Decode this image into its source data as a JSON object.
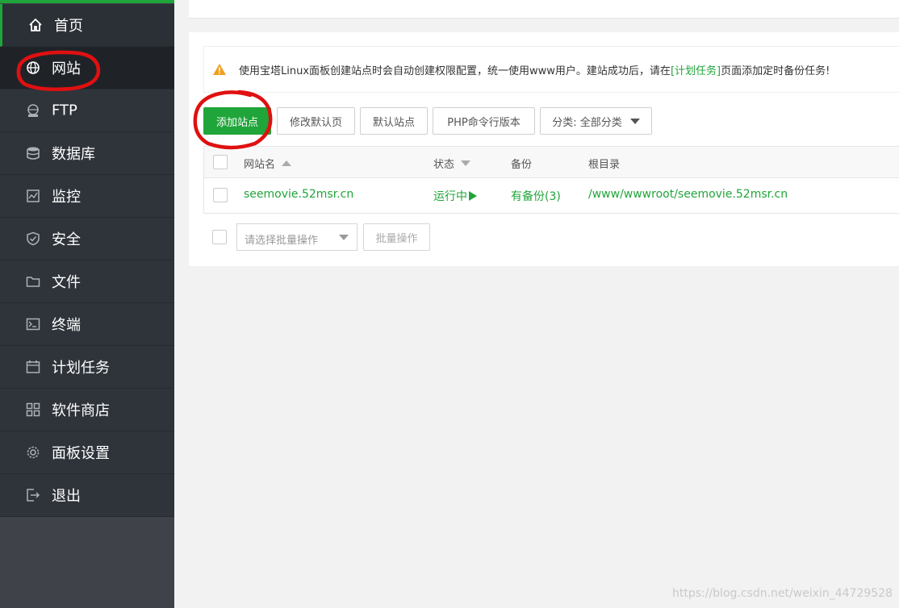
{
  "sidebar": {
    "items": [
      {
        "label": "首页",
        "icon": "home-icon"
      },
      {
        "label": "网站",
        "icon": "globe-icon"
      },
      {
        "label": "FTP",
        "icon": "ftp-icon"
      },
      {
        "label": "数据库",
        "icon": "database-icon"
      },
      {
        "label": "监控",
        "icon": "monitor-icon"
      },
      {
        "label": "安全",
        "icon": "shield-icon"
      },
      {
        "label": "文件",
        "icon": "folder-icon"
      },
      {
        "label": "终端",
        "icon": "terminal-icon"
      },
      {
        "label": "计划任务",
        "icon": "calendar-icon"
      },
      {
        "label": "软件商店",
        "icon": "apps-grid-icon"
      },
      {
        "label": "面板设置",
        "icon": "gear-icon"
      },
      {
        "label": "退出",
        "icon": "logout-icon"
      }
    ]
  },
  "notice": {
    "text_before": "使用宝塔Linux面板创建站点时会自动创建权限配置，统一使用www用户。建站成功后，请在",
    "link": "[计划任务]",
    "text_after": "页面添加定时备份任务!"
  },
  "toolbar": {
    "add_site": "添加站点",
    "modify_default_page": "修改默认页",
    "default_site": "默认站点",
    "php_cli_version": "PHP命令行版本",
    "category": "分类: 全部分类"
  },
  "table": {
    "headers": {
      "name": "网站名",
      "status": "状态",
      "backup": "备份",
      "root": "根目录"
    },
    "rows": [
      {
        "name": "seemovie.52msr.cn",
        "status": "运行中",
        "backup": "有备份(3)",
        "root": "/www/wwwroot/seemovie.52msr.cn"
      }
    ]
  },
  "batch": {
    "select_placeholder": "请选择批量操作",
    "button": "批量操作"
  },
  "watermark": "https://blog.csdn.net/weixin_44729528",
  "colors": {
    "sidebar_bg": "#3f4249",
    "sidebar_item_bg": "#2f343b",
    "accent_green": "#20a53a",
    "warning_orange": "#f0a020",
    "annotation_red": "#e01010"
  }
}
